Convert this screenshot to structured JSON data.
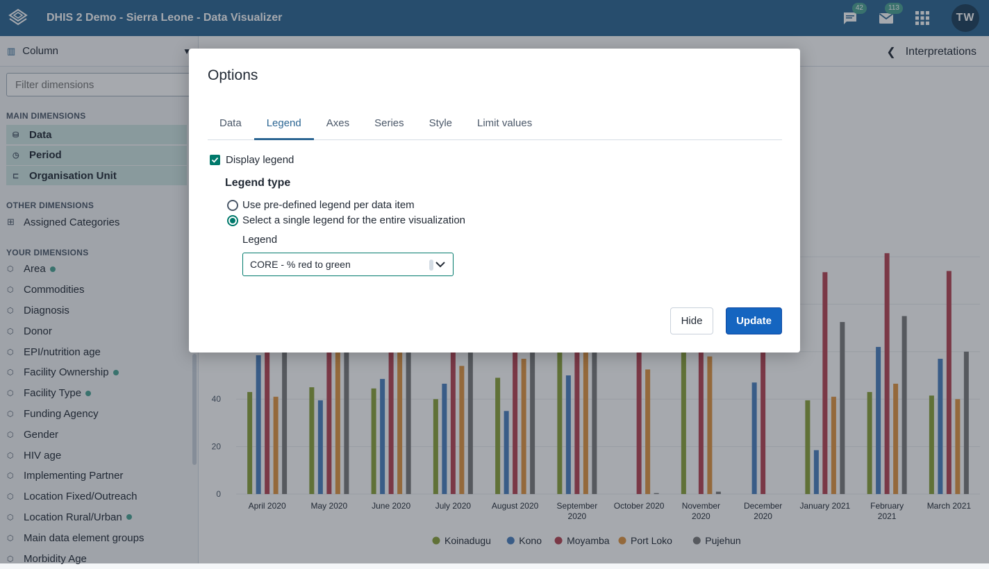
{
  "app": {
    "title": "DHIS 2 Demo - Sierra Leone - Data Visualizer",
    "avatar_initials": "TW",
    "interpretations_badge": "42",
    "messages_badge": "113"
  },
  "left_panel": {
    "vis_type": "Column",
    "filter_placeholder": "Filter dimensions",
    "main_dimensions_title": "MAIN DIMENSIONS",
    "main_dimensions": [
      {
        "label": "Data",
        "icon": "database-icon"
      },
      {
        "label": "Period",
        "icon": "clock-icon"
      },
      {
        "label": "Organisation Unit",
        "icon": "org-tree-icon"
      }
    ],
    "other_dimensions_title": "OTHER DIMENSIONS",
    "other_dimensions": [
      {
        "label": "Assigned Categories",
        "icon": "grid-icon"
      }
    ],
    "your_dimensions_title": "YOUR DIMENSIONS",
    "your_dimensions": [
      {
        "label": "Area",
        "active": true
      },
      {
        "label": "Commodities",
        "active": false
      },
      {
        "label": "Diagnosis",
        "active": false
      },
      {
        "label": "Donor",
        "active": false
      },
      {
        "label": "EPI/nutrition age",
        "active": false
      },
      {
        "label": "Facility Ownership",
        "active": true
      },
      {
        "label": "Facility Type",
        "active": true
      },
      {
        "label": "Funding Agency",
        "active": false
      },
      {
        "label": "Gender",
        "active": false
      },
      {
        "label": "HIV age",
        "active": false
      },
      {
        "label": "Implementing Partner",
        "active": false
      },
      {
        "label": "Location Fixed/Outreach",
        "active": false
      },
      {
        "label": "Location Rural/Urban",
        "active": true
      },
      {
        "label": "Main data element groups",
        "active": false
      },
      {
        "label": "Morbidity Age",
        "active": false
      }
    ]
  },
  "header": {
    "interpretations_label": "Interpretations"
  },
  "modal": {
    "title": "Options",
    "tabs": [
      "Data",
      "Legend",
      "Axes",
      "Series",
      "Style",
      "Limit values"
    ],
    "active_tab": "Legend",
    "display_legend_label": "Display legend",
    "display_legend_checked": true,
    "legend_type_title": "Legend type",
    "radio_predefined": "Use pre-defined legend per data item",
    "radio_single": "Select a single legend for the entire visualization",
    "selected_radio": "single",
    "legend_label": "Legend",
    "legend_value": "CORE - % red to green",
    "hide_button": "Hide",
    "update_button": "Update"
  },
  "chart_data": {
    "type": "bar",
    "categories": [
      "April 2020",
      "May 2020",
      "June 2020",
      "July 2020",
      "August 2020",
      "September 2020",
      "October 2020",
      "November 2020",
      "December 2020",
      "January 2021",
      "February 2021",
      "March 2021"
    ],
    "series": [
      {
        "name": "Koinadugu",
        "color": "#8aa23a",
        "values": [
          43,
          45,
          44.5,
          40,
          49,
          60,
          0,
          60,
          0,
          39.5,
          43,
          41.5
        ]
      },
      {
        "name": "Kono",
        "color": "#4a7fbf",
        "values": [
          58.5,
          39.5,
          48.5,
          46.5,
          35,
          50,
          0,
          0,
          47,
          18.5,
          62,
          57
        ]
      },
      {
        "name": "Moyamba",
        "color": "#b64453",
        "values": [
          60,
          60,
          60,
          60,
          60,
          60,
          60,
          60,
          60,
          93.5,
          101.5,
          94
        ]
      },
      {
        "name": "Port Loko",
        "color": "#e29440",
        "values": [
          41,
          60,
          60,
          54,
          57,
          60,
          52.5,
          58,
          0,
          41,
          46.5,
          40
        ]
      },
      {
        "name": "Pujehun",
        "color": "#7b7b7b",
        "values": [
          60,
          60,
          60,
          60,
          60,
          60,
          0.4,
          1,
          0,
          72.5,
          75,
          60
        ]
      }
    ],
    "y_ticks": [
      "0",
      "20",
      "40"
    ],
    "ylim": [
      0,
      110
    ]
  }
}
